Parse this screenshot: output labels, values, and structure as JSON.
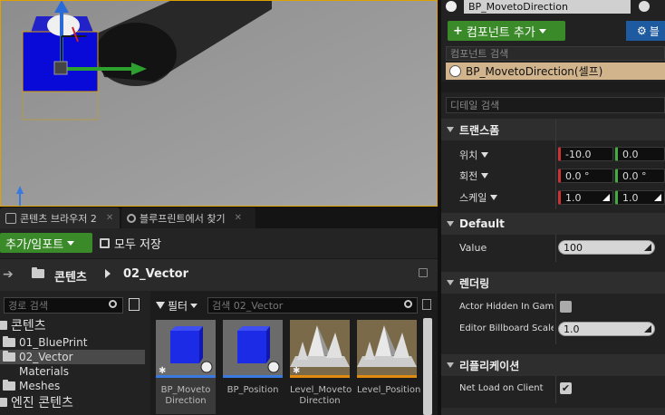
{
  "viewport": {
    "bg": "#9a9a9a"
  },
  "tabs": [
    {
      "label": "콘텐츠 브라우저 2",
      "close": "✕"
    },
    {
      "label": "블루프린트에서 찾기",
      "close": "✕"
    }
  ],
  "content_browser": {
    "add_import_label": "추가/임포트",
    "save_all_label": "모두 저장",
    "path": [
      "콘텐츠",
      "02_Vector"
    ],
    "path_search_placeholder": "경로 검색",
    "filter_label": "필터",
    "asset_search_placeholder": "검색 02_Vector",
    "tree": [
      {
        "label": "콘텐츠",
        "level": 0
      },
      {
        "label": "01_BluePrint",
        "level": 1
      },
      {
        "label": "02_Vector",
        "level": 1,
        "selected": true
      },
      {
        "label": "Materials",
        "level": 1
      },
      {
        "label": "Meshes",
        "level": 1
      },
      {
        "label": "엔진 콘텐츠",
        "level": 0
      }
    ],
    "assets": [
      {
        "name": "BP_Moveto Direction",
        "line1": "BP_Moveto",
        "line2": "Direction",
        "kind": "blueprint",
        "selected": true
      },
      {
        "name": "BP_Position",
        "line1": "BP_Position",
        "line2": "",
        "kind": "blueprint"
      },
      {
        "name": "Level_Moveto Direction",
        "line1": "Level_Moveto",
        "line2": "Direction",
        "kind": "level"
      },
      {
        "name": "Level_Position",
        "line1": "Level_Position",
        "line2": "",
        "kind": "level"
      }
    ]
  },
  "details": {
    "actor_name": "BP_MovetoDirection",
    "add_component_label": "컴포넌트 추가",
    "blueprint_button_partial": "블",
    "component_search_placeholder": "컴포넌트 검색",
    "self_component": "BP_MovetoDirection(셀프)",
    "detail_search_placeholder": "디테일 검색",
    "sections": {
      "transform": "트랜스폼",
      "default": "Default",
      "rendering": "렌더링",
      "replication": "리플리케이션"
    },
    "location_label": "위치",
    "rotation_label": "회전",
    "scale_label": "스케일",
    "location": [
      "-10.0",
      "0.0"
    ],
    "rotation": [
      "0.0 °",
      "0.0 °"
    ],
    "scale": [
      "1.0",
      "1.0"
    ],
    "value_label": "Value",
    "value": "100",
    "actor_hidden_label": "Actor Hidden In Game",
    "actor_hidden_checked": false,
    "billboard_label": "Editor Billboard Scale",
    "billboard_value": "1.0",
    "net_load_label": "Net Load on Client",
    "net_load_checked": true
  },
  "colors": {
    "accent_green": "#3a8a2a",
    "selection": "#d2b48c",
    "blue_btn": "#1e5aa0"
  }
}
